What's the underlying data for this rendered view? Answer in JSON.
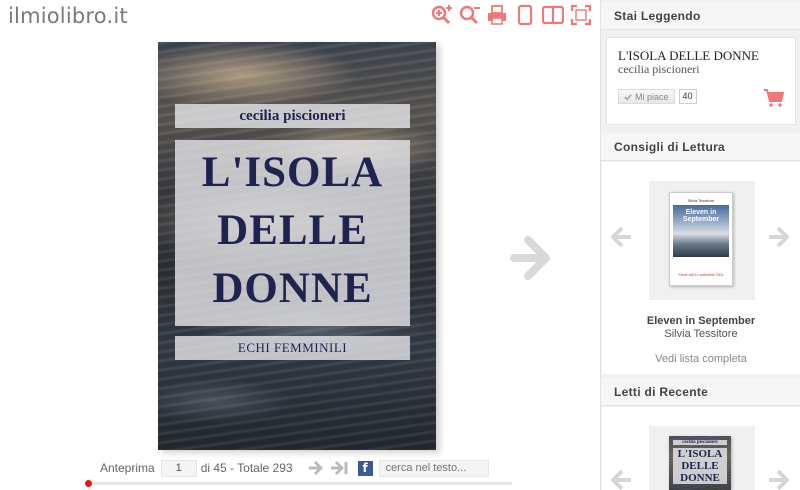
{
  "header": {
    "logo": "ilmiolibro.it",
    "tools": [
      "zoom-in-icon",
      "zoom-out-icon",
      "print-icon",
      "single-page-icon",
      "double-page-icon",
      "fullscreen-icon"
    ],
    "accent_color": "#f07878"
  },
  "book": {
    "author": "cecilia piscioneri",
    "title_lines": [
      "L'ISOLA",
      "DELLE",
      "DONNE"
    ],
    "series": "ECHI FEMMINILI"
  },
  "footer": {
    "preview_label": "Anteprima",
    "page_value": "1",
    "of_total": "di 45 - Totale 293",
    "search_placeholder": "cerca nel testo...",
    "facebook_letter": "f",
    "progress": 0.0
  },
  "sidebar": {
    "reading": {
      "heading": "Stai Leggendo",
      "title": "L'ISOLA DELLE DONNE",
      "author": "cecilia piscioneri",
      "like_label": "Mi piace",
      "like_count": "40"
    },
    "recommendations": {
      "heading": "Consigli di Lettura",
      "title": "Eleven in September",
      "author": "Silvia Tessitore",
      "see_all": "Vedi lista completa",
      "thumb_author": "Silvia Tessitore",
      "thumb_title": "Eleven in September",
      "thumb_subtitle": "Storie dell'11 settembre 2001"
    },
    "recent": {
      "heading": "Letti di Recente",
      "thumb_author": "cecilia piscioneri",
      "thumb_title_lines": [
        "L'ISOLA",
        "DELLE",
        "DONNE"
      ]
    }
  }
}
